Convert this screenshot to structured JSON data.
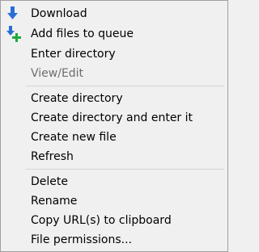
{
  "menu": {
    "items": [
      {
        "label": "Download",
        "icon": "download-arrow-icon",
        "enabled": true
      },
      {
        "label": "Add files to queue",
        "icon": "add-to-queue-icon",
        "enabled": true
      },
      {
        "label": "Enter directory",
        "icon": "",
        "enabled": true
      },
      {
        "label": "View/Edit",
        "icon": "",
        "enabled": false
      },
      {
        "label": "Create directory",
        "icon": "",
        "enabled": true
      },
      {
        "label": "Create directory and enter it",
        "icon": "",
        "enabled": true
      },
      {
        "label": "Create new file",
        "icon": "",
        "enabled": true
      },
      {
        "label": "Refresh",
        "icon": "",
        "enabled": true
      },
      {
        "label": "Delete",
        "icon": "",
        "enabled": true
      },
      {
        "label": "Rename",
        "icon": "",
        "enabled": true
      },
      {
        "label": "Copy URL(s) to clipboard",
        "icon": "",
        "enabled": true
      },
      {
        "label": "File permissions...",
        "icon": "",
        "enabled": true
      }
    ]
  },
  "colors": {
    "icon_blue": "#2a6fd6",
    "icon_green": "#1faa3a",
    "disabled_text": "#6d6d6d"
  }
}
